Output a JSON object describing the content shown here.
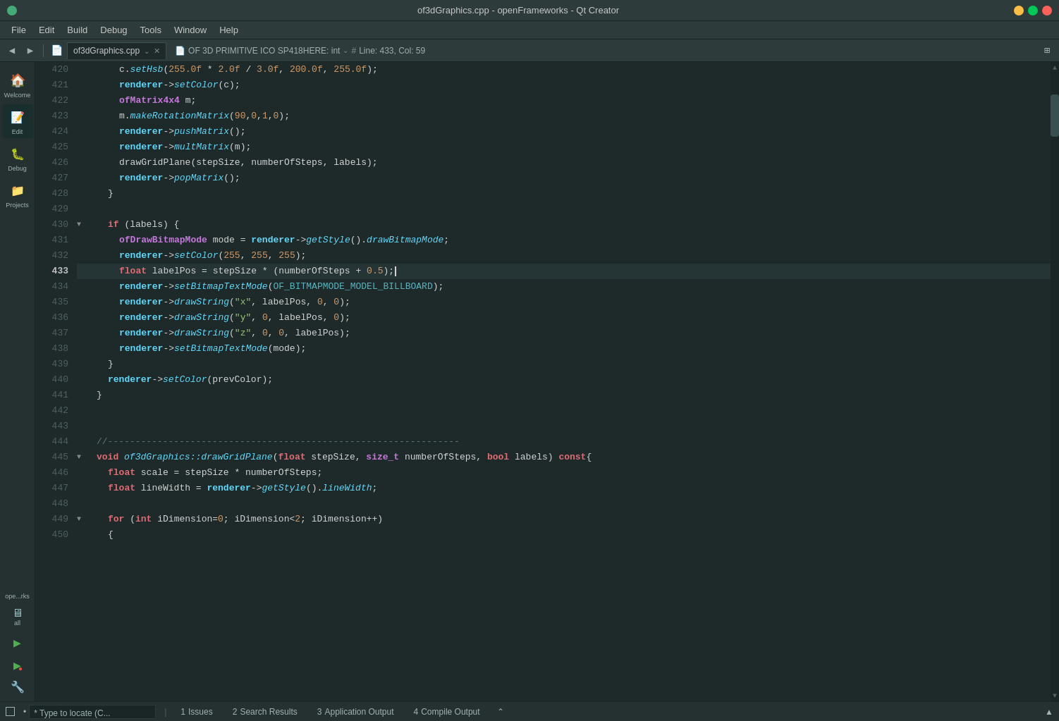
{
  "titlebar": {
    "title": "of3dGraphics.cpp - openFrameworks - Qt Creator"
  },
  "menubar": {
    "items": [
      "File",
      "Edit",
      "Build",
      "Debug",
      "Tools",
      "Window",
      "Help"
    ]
  },
  "toolbar": {
    "back_label": "◀",
    "forward_label": "▶",
    "tab_filename": "of3dGraphics.cpp",
    "breadcrumb": "OF  3D  PRIMITIVE  ICO  SP418HERE: int",
    "line_col": "Line: 433, Col: 59"
  },
  "sidebar": {
    "items": [
      {
        "id": "welcome",
        "label": "Welcome",
        "icon": "🏠"
      },
      {
        "id": "edit",
        "label": "Edit",
        "icon": "📄"
      },
      {
        "id": "debug",
        "label": "Debug",
        "icon": "🐛"
      },
      {
        "id": "projects",
        "label": "Projects",
        "icon": "📁"
      }
    ],
    "bottom_label": "ope...rks",
    "bottom_items": [
      {
        "id": "all",
        "label": "all",
        "icon": "🖥"
      },
      {
        "id": "run",
        "label": "",
        "icon": "▶"
      },
      {
        "id": "run2",
        "label": "",
        "icon": "▶"
      },
      {
        "id": "run3",
        "label": "",
        "icon": "⚙"
      }
    ]
  },
  "code": {
    "lines": [
      {
        "num": 420,
        "indent": 3,
        "content": "c.setHsb(255.0f * 2.0f / 3.0f, 200.0f, 255.0f);",
        "fold": false,
        "active": false
      },
      {
        "num": 421,
        "indent": 3,
        "content": "renderer->setColor(c);",
        "fold": false,
        "active": false
      },
      {
        "num": 422,
        "indent": 3,
        "content": "ofMatrix4x4 m;",
        "fold": false,
        "active": false
      },
      {
        "num": 423,
        "indent": 3,
        "content": "m.makeRotationMatrix(90,0,1,0);",
        "fold": false,
        "active": false
      },
      {
        "num": 424,
        "indent": 3,
        "content": "renderer->pushMatrix();",
        "fold": false,
        "active": false
      },
      {
        "num": 425,
        "indent": 3,
        "content": "renderer->multMatrix(m);",
        "fold": false,
        "active": false
      },
      {
        "num": 426,
        "indent": 3,
        "content": "drawGridPlane(stepSize, numberOfSteps, labels);",
        "fold": false,
        "active": false
      },
      {
        "num": 427,
        "indent": 3,
        "content": "renderer->popMatrix();",
        "fold": false,
        "active": false
      },
      {
        "num": 428,
        "indent": 2,
        "content": "}",
        "fold": false,
        "active": false
      },
      {
        "num": 429,
        "indent": 0,
        "content": "",
        "fold": false,
        "active": false
      },
      {
        "num": 430,
        "indent": 2,
        "content": "if (labels) {",
        "fold": true,
        "active": false
      },
      {
        "num": 431,
        "indent": 3,
        "content": "ofDrawBitmapMode mode = renderer->getStyle().drawBitmapMode;",
        "fold": false,
        "active": false
      },
      {
        "num": 432,
        "indent": 3,
        "content": "renderer->setColor(255, 255, 255);",
        "fold": false,
        "active": false
      },
      {
        "num": 433,
        "indent": 3,
        "content": "float labelPos = stepSize * (numberOfSteps + 0.5);|",
        "fold": false,
        "active": true
      },
      {
        "num": 434,
        "indent": 3,
        "content": "renderer->setBitmapTextMode(OF_BITMAPMODE_MODEL_BILLBOARD);",
        "fold": false,
        "active": false
      },
      {
        "num": 435,
        "indent": 3,
        "content": "renderer->drawString(\"x\", labelPos, 0, 0);",
        "fold": false,
        "active": false
      },
      {
        "num": 436,
        "indent": 3,
        "content": "renderer->drawString(\"y\", 0, labelPos, 0);",
        "fold": false,
        "active": false
      },
      {
        "num": 437,
        "indent": 3,
        "content": "renderer->drawString(\"z\", 0, 0, labelPos);",
        "fold": false,
        "active": false
      },
      {
        "num": 438,
        "indent": 3,
        "content": "renderer->setBitmapTextMode(mode);",
        "fold": false,
        "active": false
      },
      {
        "num": 439,
        "indent": 2,
        "content": "}",
        "fold": false,
        "active": false
      },
      {
        "num": 440,
        "indent": 2,
        "content": "renderer->setColor(prevColor);",
        "fold": false,
        "active": false
      },
      {
        "num": 441,
        "indent": 1,
        "content": "}",
        "fold": false,
        "active": false
      },
      {
        "num": 442,
        "indent": 0,
        "content": "",
        "fold": false,
        "active": false
      },
      {
        "num": 443,
        "indent": 0,
        "content": "",
        "fold": false,
        "active": false
      },
      {
        "num": 444,
        "indent": 1,
        "content": "//----------------------------------------------------------------",
        "fold": false,
        "active": false
      },
      {
        "num": 445,
        "indent": 1,
        "content": "void of3dGraphics::drawGridPlane(float stepSize, size_t numberOfSteps, bool labels) const{",
        "fold": true,
        "active": false
      },
      {
        "num": 446,
        "indent": 2,
        "content": "float scale = stepSize * numberOfSteps;",
        "fold": false,
        "active": false
      },
      {
        "num": 447,
        "indent": 2,
        "content": "float lineWidth = renderer->getStyle().lineWidth;",
        "fold": false,
        "active": false
      },
      {
        "num": 448,
        "indent": 0,
        "content": "",
        "fold": false,
        "active": false
      },
      {
        "num": 449,
        "indent": 2,
        "content": "for (int iDimension=0; iDimension<2; iDimension++)",
        "fold": true,
        "active": false
      },
      {
        "num": 450,
        "indent": 2,
        "content": "{",
        "fold": false,
        "active": false
      }
    ]
  },
  "statusbar": {
    "locate_placeholder": "* Type to locate (C...",
    "tabs": [
      {
        "num": "1",
        "label": "Issues"
      },
      {
        "num": "2",
        "label": "Search Results"
      },
      {
        "num": "3",
        "label": "Application Output"
      },
      {
        "num": "4",
        "label": "Compile Output"
      }
    ]
  },
  "colors": {
    "bg": "#1e2a2a",
    "sidebar_bg": "#253030",
    "toolbar_bg": "#2d3b3b",
    "active_line": "#253535",
    "keyword": "#e06c75",
    "type_color": "#56b6c2",
    "function_color": "#61dafb",
    "string_color": "#98c379",
    "number_color": "#d19a66",
    "comment_color": "#5c7a7a"
  }
}
